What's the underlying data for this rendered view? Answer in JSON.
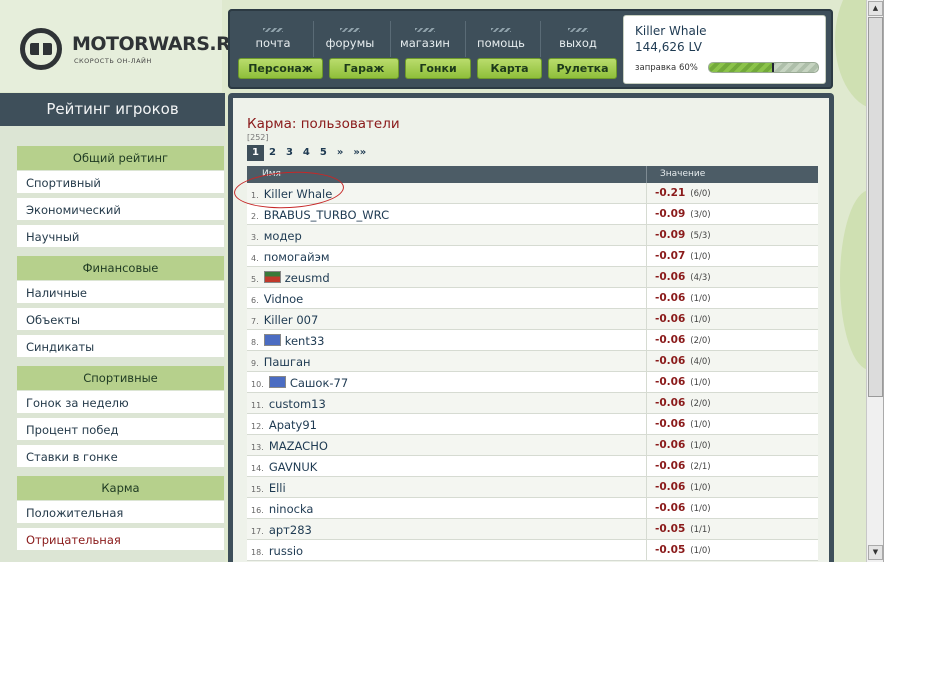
{
  "logo": {
    "name": "MOTORWARS.RU",
    "tagline": "СКОРОСТЬ ОН-ЛАЙН"
  },
  "topnav": {
    "links": [
      {
        "label": "почта"
      },
      {
        "label": "форумы"
      },
      {
        "label": "магазин"
      },
      {
        "label": "помощь"
      },
      {
        "label": "выход"
      }
    ],
    "buttons": [
      {
        "label": "Персонаж"
      },
      {
        "label": "Гараж"
      },
      {
        "label": "Гонки"
      },
      {
        "label": "Карта"
      },
      {
        "label": "Рулетка"
      }
    ]
  },
  "user": {
    "name": "Killer Whale",
    "level": "144,626 LV",
    "fuel_label": "заправка 60%",
    "fuel_fraction": 0.6
  },
  "sidebar": {
    "title": "Рейтинг игроков",
    "sections": [
      {
        "heading": "Общий рейтинг",
        "items": [
          "Спортивный",
          "Экономический",
          "Научный"
        ]
      },
      {
        "heading": "Финансовые",
        "items": [
          "Наличные",
          "Объекты",
          "Синдикаты"
        ]
      },
      {
        "heading": "Спортивные",
        "items": [
          "Гонок за неделю",
          "Процент побед",
          "Ставки в гонке"
        ]
      },
      {
        "heading": "Карма",
        "items": [
          "Положительная",
          "Отрицательная"
        ]
      }
    ],
    "active_item": "Отрицательная"
  },
  "main": {
    "title": "Карма: пользователи",
    "count": "[252]",
    "pager": [
      "1",
      "2",
      "3",
      "4",
      "5",
      "»",
      "»»"
    ],
    "current_page": "1",
    "columns": [
      "Имя",
      "Значение"
    ],
    "rows": [
      {
        "num": "1.",
        "name": "Killer Whale",
        "value": "-0.21",
        "votes": "(6/0)"
      },
      {
        "num": "2.",
        "name": "BRABUS_TURBO_WRC",
        "value": "-0.09",
        "votes": "(3/0)"
      },
      {
        "num": "3.",
        "name": "модер",
        "value": "-0.09",
        "votes": "(5/3)"
      },
      {
        "num": "4.",
        "name": "помогайэм",
        "value": "-0.07",
        "votes": "(1/0)"
      },
      {
        "num": "5.",
        "name": "zeusmd",
        "value": "-0.06",
        "votes": "(4/3)",
        "flag": "team1"
      },
      {
        "num": "6.",
        "name": "Vidnoe",
        "value": "-0.06",
        "votes": "(1/0)"
      },
      {
        "num": "7.",
        "name": "Killer 007",
        "value": "-0.06",
        "votes": "(1/0)"
      },
      {
        "num": "8.",
        "name": "kent33",
        "value": "-0.06",
        "votes": "(2/0)",
        "flag": "team2"
      },
      {
        "num": "9.",
        "name": "Пашган",
        "value": "-0.06",
        "votes": "(4/0)"
      },
      {
        "num": "10.",
        "name": "Сашок-77",
        "value": "-0.06",
        "votes": "(1/0)",
        "flag": "team2"
      },
      {
        "num": "11.",
        "name": "custom13",
        "value": "-0.06",
        "votes": "(2/0)"
      },
      {
        "num": "12.",
        "name": "Apaty91",
        "value": "-0.06",
        "votes": "(1/0)"
      },
      {
        "num": "13.",
        "name": "MAZACHO",
        "value": "-0.06",
        "votes": "(1/0)"
      },
      {
        "num": "14.",
        "name": "GAVNUK",
        "value": "-0.06",
        "votes": "(2/1)"
      },
      {
        "num": "15.",
        "name": "Elli",
        "value": "-0.06",
        "votes": "(1/0)"
      },
      {
        "num": "16.",
        "name": "ninocka",
        "value": "-0.06",
        "votes": "(1/0)"
      },
      {
        "num": "17.",
        "name": "apт283",
        "value": "-0.05",
        "votes": "(1/1)"
      },
      {
        "num": "18.",
        "name": "russio",
        "value": "-0.05",
        "votes": "(1/0)"
      }
    ]
  },
  "colors": {
    "accent_green": "#b6d08c",
    "dark_panel": "#3e4f5a",
    "negative_red": "#8a1a1a",
    "annotation_red": "#c62828"
  }
}
